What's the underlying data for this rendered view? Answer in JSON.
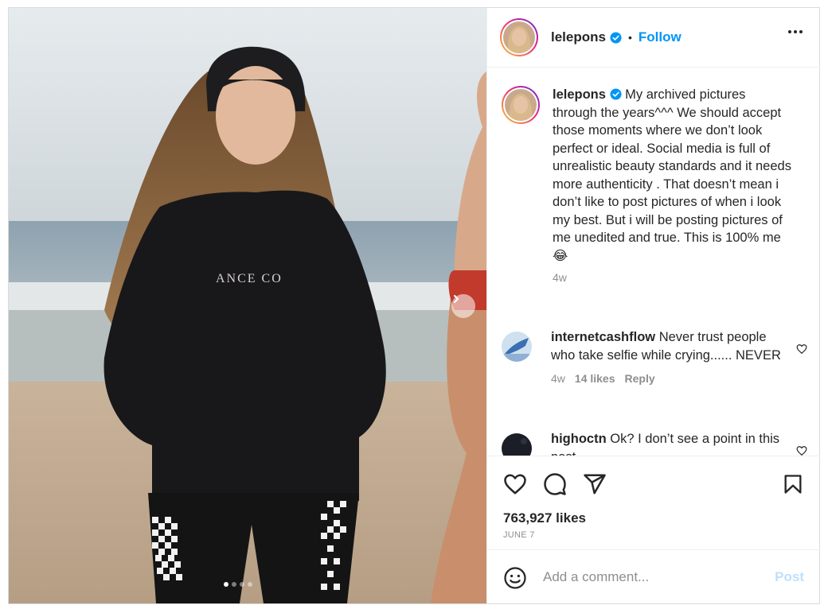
{
  "header": {
    "username": "lelepons",
    "separator": "•",
    "follow_label": "Follow"
  },
  "caption": {
    "username": "lelepons",
    "text": "My archived pictures through the years^^^ We should accept those moments where we don’t look perfect or ideal. Social media is full of unrealistic beauty standards and it needs more authenticity . That doesn’t mean i don’t like to post pictures of when i look my best. But i will be posting pictures of me unedited and true. This is 100% me",
    "emoji": "😂",
    "time": "4w"
  },
  "comments": [
    {
      "username": "internetcashflow",
      "text": "Never trust people who take selfie while crying...... NEVER",
      "time": "4w",
      "likes": "14 likes",
      "reply": "Reply"
    },
    {
      "username": "highoctn",
      "text": "Ok? I don’t see a point in this post"
    }
  ],
  "stats": {
    "likes": "763,927 likes",
    "date": "JUNE 7"
  },
  "add_comment": {
    "placeholder": "Add a comment...",
    "post_label": "Post"
  },
  "carousel": {
    "total": 4,
    "active_index": 0
  },
  "icons": [
    "verified-icon",
    "more-icon",
    "heart-icon",
    "comment-icon",
    "share-icon",
    "save-icon",
    "emoji-icon",
    "chevron-right-icon"
  ],
  "colors": {
    "link": "#0095f6",
    "post_disabled": "#c0dffd",
    "verified": "#0095f6",
    "muted": "#8e8e8e"
  }
}
